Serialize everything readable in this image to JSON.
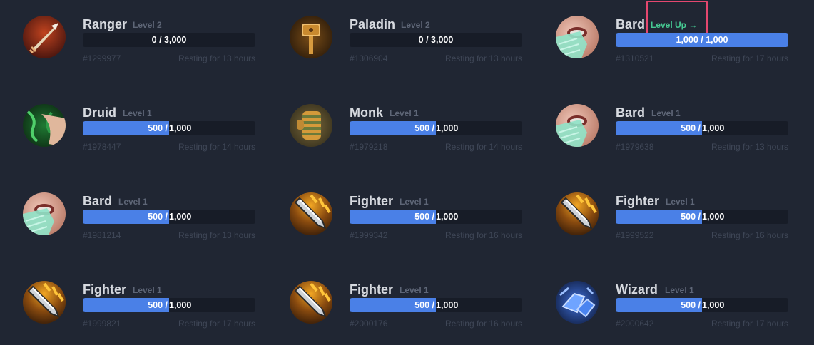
{
  "colors": {
    "background": "#202633",
    "bar_track": "#171c27",
    "bar_fill": "#4a80e7",
    "level_up": "#46c892",
    "highlight_border": "#e4476f"
  },
  "cards": [
    {
      "name": "Ranger",
      "level": "Level 2",
      "progress_text": "0 / 3,000",
      "progress": 0,
      "id": "#1299977",
      "status": "Resting for 13 hours",
      "icon": "ranger-icon"
    },
    {
      "name": "Paladin",
      "level": "Level 2",
      "progress_text": "0 / 3,000",
      "progress": 0,
      "id": "#1306904",
      "status": "Resting for 13 hours",
      "icon": "paladin-icon"
    },
    {
      "name": "Bard",
      "level_up_label": "Level Up →",
      "progress_text": "1,000 / 1,000",
      "progress": 1,
      "id": "#1310521",
      "status": "Resting for 17 hours",
      "icon": "bard-icon"
    },
    {
      "name": "Druid",
      "level": "Level 1",
      "progress_a": "500 /",
      "progress_b": "1,000",
      "progress": 0.5,
      "id": "#1978447",
      "status": "Resting for 14 hours",
      "icon": "druid-icon"
    },
    {
      "name": "Monk",
      "level": "Level 1",
      "progress_a": "500 /",
      "progress_b": "1,000",
      "progress": 0.5,
      "id": "#1979218",
      "status": "Resting for 14 hours",
      "icon": "monk-icon"
    },
    {
      "name": "Bard",
      "level": "Level 1",
      "progress_a": "500 /",
      "progress_b": "1,000",
      "progress": 0.5,
      "id": "#1979638",
      "status": "Resting for 13 hours",
      "icon": "bard-icon"
    },
    {
      "name": "Bard",
      "level": "Level 1",
      "progress_a": "500 /",
      "progress_b": "1,000",
      "progress": 0.5,
      "id": "#1981214",
      "status": "Resting for 13 hours",
      "icon": "bard-icon"
    },
    {
      "name": "Fighter",
      "level": "Level 1",
      "progress_a": "500 /",
      "progress_b": "1,000",
      "progress": 0.5,
      "id": "#1999342",
      "status": "Resting for 16 hours",
      "icon": "fighter-icon"
    },
    {
      "name": "Fighter",
      "level": "Level 1",
      "progress_a": "500 /",
      "progress_b": "1,000",
      "progress": 0.5,
      "id": "#1999522",
      "status": "Resting for 16 hours",
      "icon": "fighter-icon"
    },
    {
      "name": "Fighter",
      "level": "Level 1",
      "progress_a": "500 /",
      "progress_b": "1,000",
      "progress": 0.5,
      "id": "#1999821",
      "status": "Resting for 17 hours",
      "icon": "fighter-icon"
    },
    {
      "name": "Fighter",
      "level": "Level 1",
      "progress_a": "500 /",
      "progress_b": "1,000",
      "progress": 0.5,
      "id": "#2000176",
      "status": "Resting for 16 hours",
      "icon": "fighter-icon"
    },
    {
      "name": "Wizard",
      "level": "Level 1",
      "progress_a": "500 /",
      "progress_b": "1,000",
      "progress": 0.5,
      "id": "#2000642",
      "status": "Resting for 17 hours",
      "icon": "wizard-icon"
    }
  ]
}
